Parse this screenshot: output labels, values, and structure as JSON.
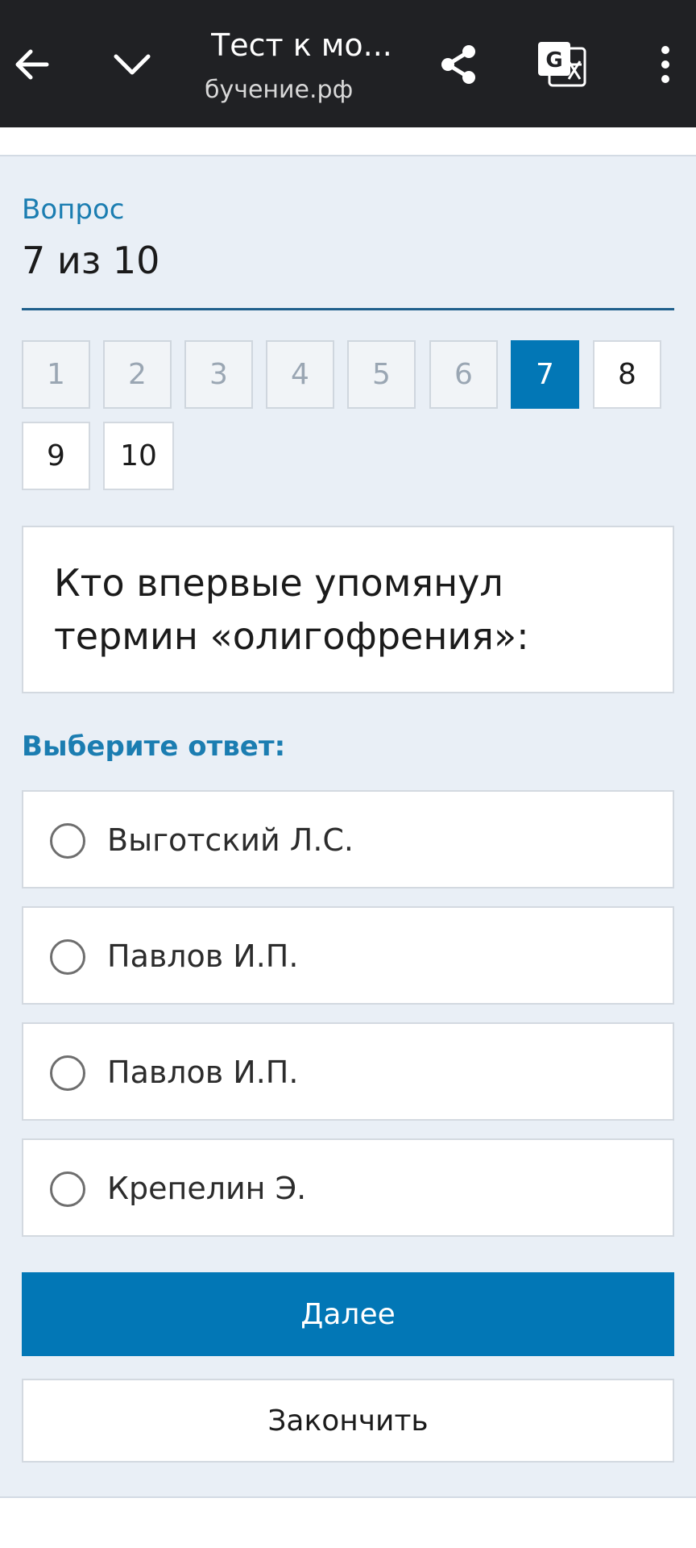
{
  "browser": {
    "title": "Тест к мо...",
    "url": "бучение.рф",
    "icons": {
      "back": "arrow-left-icon",
      "collapse": "chevron-down-icon",
      "share": "share-icon",
      "translate": "translate-icon",
      "menu": "more-vert-icon"
    }
  },
  "quiz": {
    "question_label": "Вопрос",
    "question_count": "7 из 10",
    "current": 7,
    "numbers": [
      "1",
      "2",
      "3",
      "4",
      "5",
      "6",
      "7",
      "8",
      "9",
      "10"
    ],
    "question_text": "Кто впервые упомянул термин «олигофрения»:",
    "answer_label": "Выберите ответ:",
    "options": [
      "Выготский Л.С.",
      "Павлов И.П.",
      "Павлов И.П.",
      "Крепелин Э."
    ],
    "next_label": "Далее",
    "finish_label": "Закончить"
  },
  "colors": {
    "accent": "#0277b6",
    "label_blue": "#1b7db1",
    "toolbar": "#202124",
    "page_bg": "#e9eff6"
  }
}
